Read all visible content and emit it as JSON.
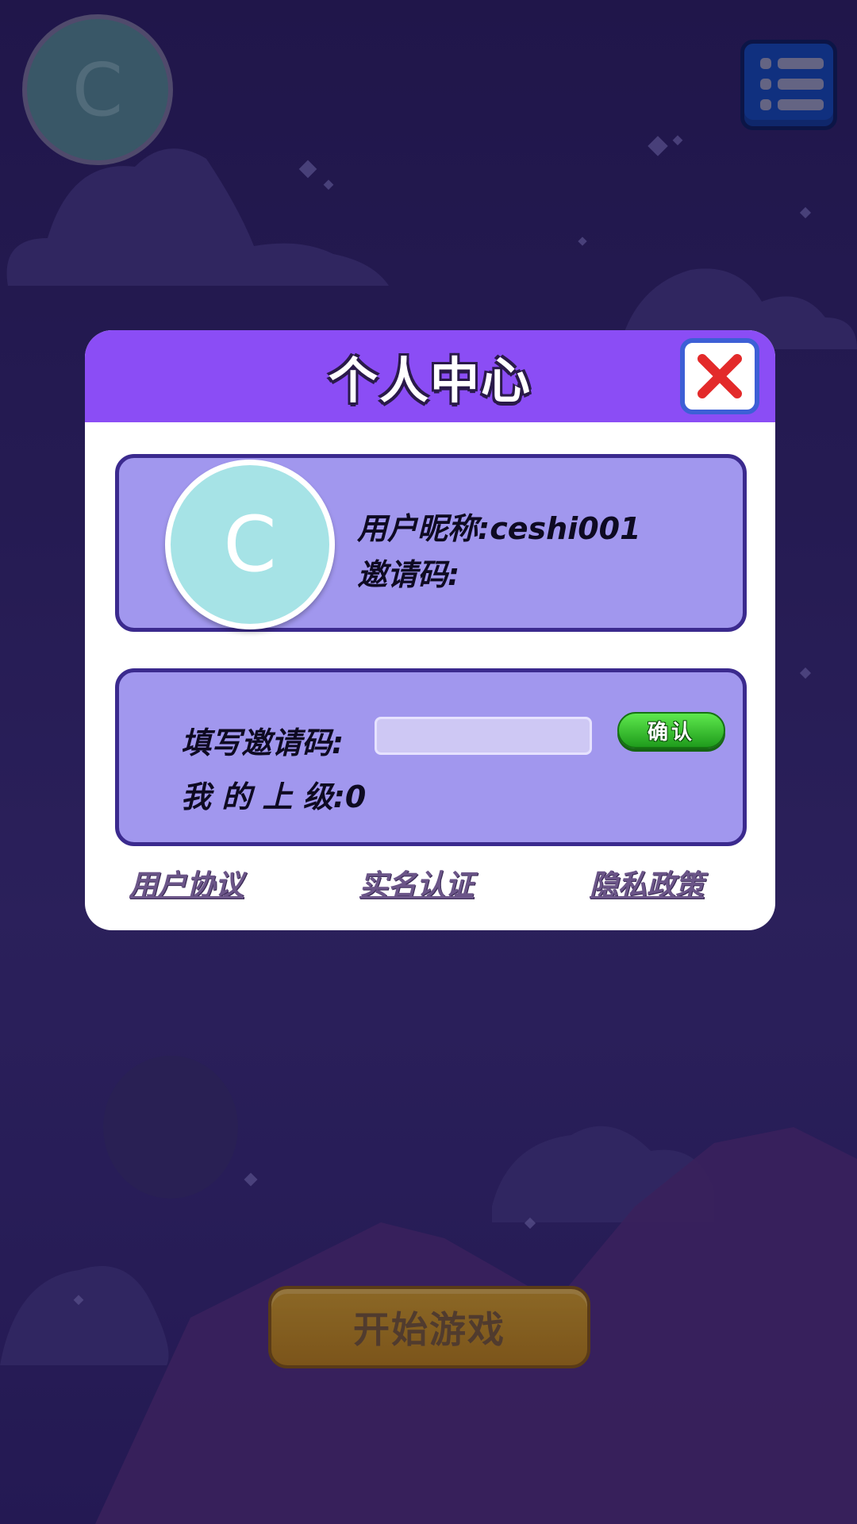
{
  "top_bar": {
    "avatar_letter": "C",
    "menu_icon": "list-menu-icon"
  },
  "modal": {
    "title": "个人中心",
    "close_icon": "close-x-icon",
    "profile": {
      "avatar_letter": "C",
      "nickname_label": "用户昵称:",
      "nickname_value": "ceshi001",
      "invite_code_label": "邀请码:",
      "invite_code_value": ""
    },
    "invite": {
      "fill_label": "填写邀请码:",
      "input_value": "",
      "input_placeholder": "",
      "confirm_label": "确认",
      "superior_label": "我 的 上 级:",
      "superior_value": "0"
    },
    "links": {
      "user_agreement": "用户协议",
      "real_name": "实名认证",
      "privacy_policy": "隐私政策"
    }
  },
  "start_button": {
    "label": "开始游戏"
  },
  "colors": {
    "header_purple": "#8b4df5",
    "panel_lavender": "#a197ee",
    "close_red": "#e32a2a",
    "confirm_green": "#2fbf2a",
    "start_gold": "#c9981a"
  }
}
